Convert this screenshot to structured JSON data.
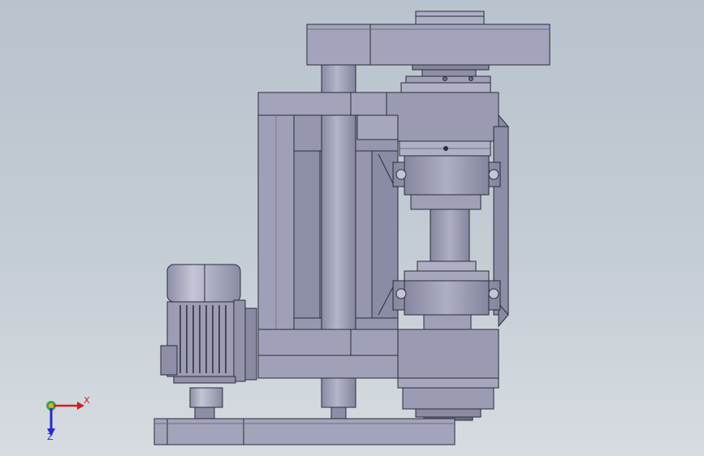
{
  "viewport": {
    "background_top": "#b9c3cd",
    "background_bottom": "#d6dce1"
  },
  "model": {
    "part_color": "#9b9cb4",
    "part_shade": "#8c8da6",
    "part_highlight": "#b2b3c9",
    "edge_color": "#2b2c38"
  },
  "triad": {
    "x_label": "X",
    "z_label": "Z",
    "x_color": "#d21e1e",
    "y_color": "#1e9e2e",
    "z_color": "#2a2ad0"
  }
}
